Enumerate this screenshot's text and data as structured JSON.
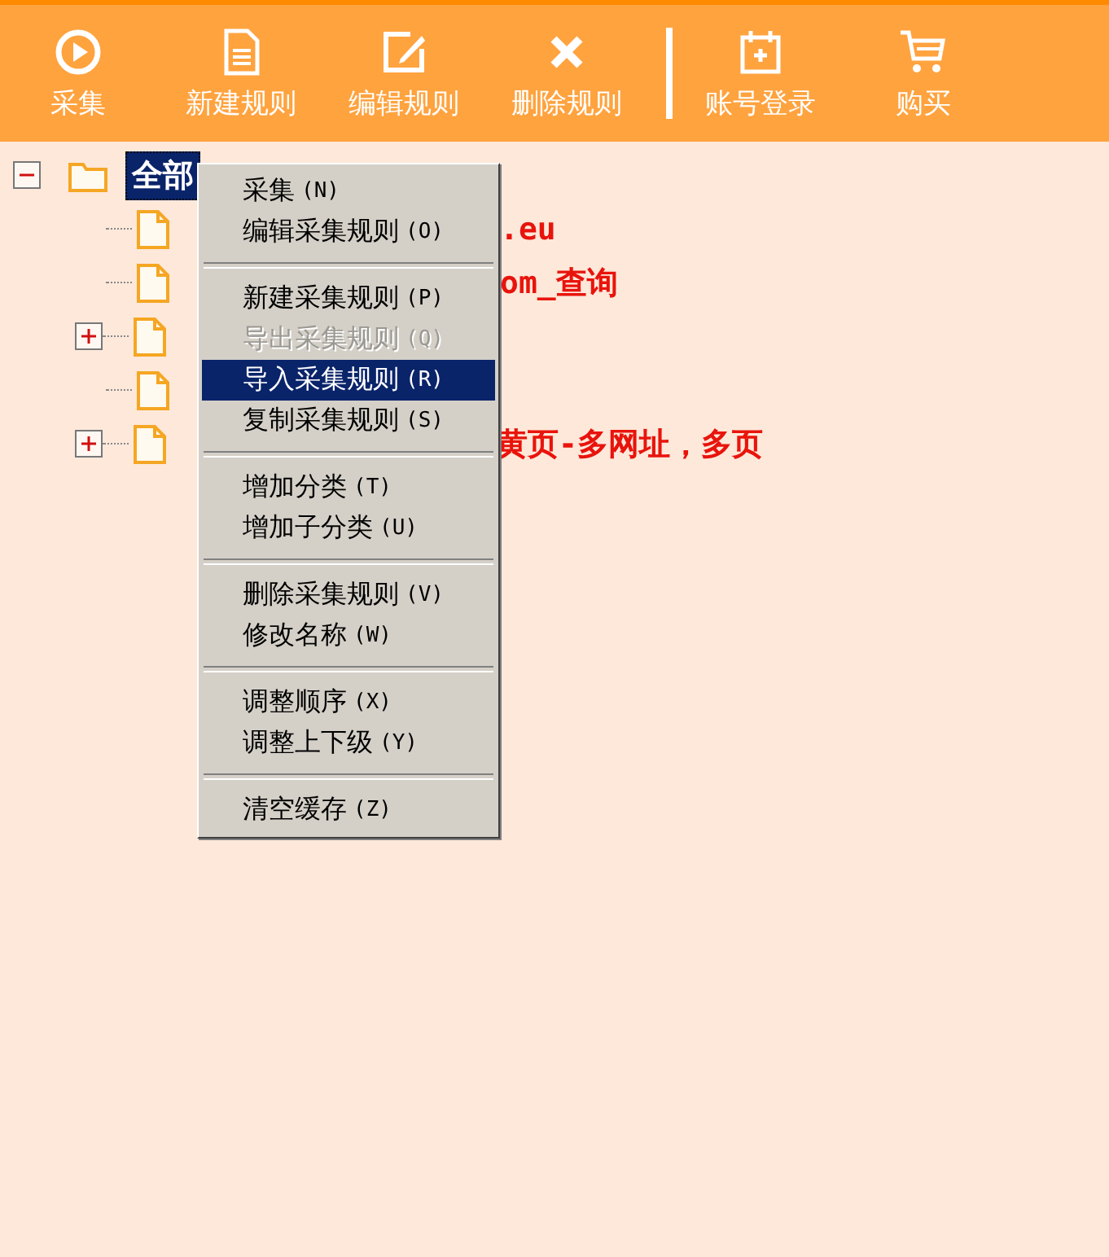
{
  "toolbar": [
    {
      "kind": "play",
      "label": "采集"
    },
    {
      "kind": "doc",
      "label": "新建规则"
    },
    {
      "kind": "edit",
      "label": "编辑规则"
    },
    {
      "kind": "delete",
      "label": "删除规则"
    },
    {
      "kind": "divider"
    },
    {
      "kind": "calendar",
      "label": "账号登录"
    },
    {
      "kind": "cart",
      "label": "购买"
    }
  ],
  "tree": {
    "label": "全部",
    "expanded": true,
    "selected": true,
    "children": [
      {
        "label_end": ".eu",
        "has_children": false
      },
      {
        "label_end": "om_查询",
        "has_children": false
      },
      {
        "has_children": true
      },
      {
        "has_children": false
      },
      {
        "label_end": "黄页-多网址，多页",
        "has_children": true
      }
    ]
  },
  "context_menu": [
    {
      "kind": "item",
      "label": "采集",
      "shortcut": "(N)",
      "disabled": false,
      "selected": false
    },
    {
      "kind": "item",
      "label": "编辑采集规则",
      "shortcut": "(O)",
      "disabled": false,
      "selected": false
    },
    {
      "kind": "separator"
    },
    {
      "kind": "item",
      "label": "新建采集规则",
      "shortcut": "(P)",
      "disabled": false,
      "selected": false
    },
    {
      "kind": "item",
      "label": "导出采集规则",
      "shortcut": "(Q)",
      "disabled": true,
      "selected": false
    },
    {
      "kind": "item",
      "label": "导入采集规则",
      "shortcut": "(R)",
      "disabled": false,
      "selected": true
    },
    {
      "kind": "item",
      "label": "复制采集规则",
      "shortcut": "(S)",
      "disabled": false,
      "selected": false
    },
    {
      "kind": "separator"
    },
    {
      "kind": "item",
      "label": "增加分类",
      "shortcut": "(T)",
      "disabled": false,
      "selected": false
    },
    {
      "kind": "item",
      "label": "增加子分类",
      "shortcut": "(U)",
      "disabled": false,
      "selected": false
    },
    {
      "kind": "separator"
    },
    {
      "kind": "item",
      "label": "删除采集规则",
      "shortcut": "(V)",
      "disabled": false,
      "selected": false
    },
    {
      "kind": "item",
      "label": "修改名称",
      "shortcut": "(W)",
      "disabled": false,
      "selected": false
    },
    {
      "kind": "separator"
    },
    {
      "kind": "item",
      "label": "调整顺序",
      "shortcut": "(X)",
      "disabled": false,
      "selected": false
    },
    {
      "kind": "item",
      "label": "调整上下级",
      "shortcut": "(Y)",
      "disabled": false,
      "selected": false
    },
    {
      "kind": "separator"
    },
    {
      "kind": "item",
      "label": "清空缓存",
      "shortcut": "(Z)",
      "disabled": false,
      "selected": false
    }
  ]
}
